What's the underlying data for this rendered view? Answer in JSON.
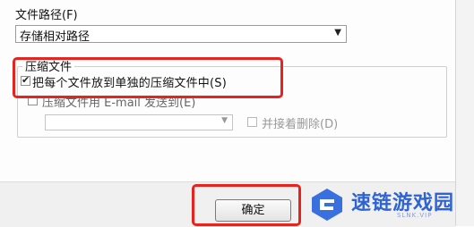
{
  "path_section": {
    "label": "文件路径(F)",
    "selected_value": "存储相对路径"
  },
  "compression_group": {
    "title": "压缩文件",
    "option_each_file": {
      "label": "把每个文件放到单独的压缩文件中(S)",
      "checked": true
    },
    "option_email": {
      "label": "压缩文件用 E-mail 发送到(E)",
      "checked": false
    },
    "email_value": "",
    "option_delete_after": {
      "label": "并接着删除(D)",
      "checked": false
    }
  },
  "footer": {
    "ok_label": "确定"
  },
  "watermark": {
    "text": "速链游戏园",
    "sub": "SLNK.VIP"
  },
  "colors": {
    "highlight": "#e8231f",
    "watermark": "#2e63d3"
  }
}
